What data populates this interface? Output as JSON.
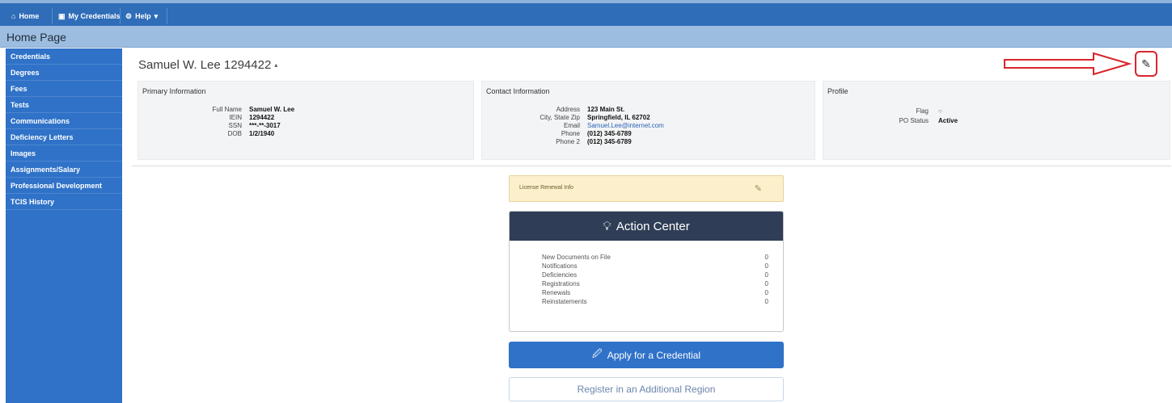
{
  "topnav": {
    "home": "Home",
    "my_credentials": "My Credentials",
    "help": "Help"
  },
  "page_title": "Home Page",
  "sidebar": {
    "items": [
      {
        "label": "Credentials"
      },
      {
        "label": "Degrees"
      },
      {
        "label": "Fees"
      },
      {
        "label": "Tests"
      },
      {
        "label": "Communications"
      },
      {
        "label": "Deficiency Letters"
      },
      {
        "label": "Images"
      },
      {
        "label": "Assignments/Salary"
      },
      {
        "label": "Professional Development"
      },
      {
        "label": "TCIS History"
      }
    ]
  },
  "person": {
    "name": "Samuel W. Lee 1294422",
    "caret": "▴"
  },
  "primary": {
    "title": "Primary Information",
    "rows": [
      {
        "k": "Full Name",
        "v": "Samuel W. Lee"
      },
      {
        "k": "IEIN",
        "v": "1294422"
      },
      {
        "k": "SSN",
        "v": "***-**-3017"
      },
      {
        "k": "DOB",
        "v": "1/2/1940"
      }
    ]
  },
  "contact": {
    "title": "Contact Information",
    "rows": [
      {
        "k": "Address",
        "v": "123 Main St."
      },
      {
        "k": "City, State Zip",
        "v": "Springfield, IL 62702"
      },
      {
        "k": "Email",
        "v": "Samuel.Lee@internet.com"
      },
      {
        "k": "Phone",
        "v": "(012) 345-6789"
      },
      {
        "k": "Phone 2",
        "v": "(012) 345-6789"
      }
    ]
  },
  "profile": {
    "title": "Profile",
    "flag_label": "Flag",
    "flag_value": "○",
    "status_label": "PO Status",
    "status_value": "Active"
  },
  "license": {
    "label": "License Renewal Info"
  },
  "action_center": {
    "title": "Action Center",
    "rows": [
      {
        "label": "New Documents on File",
        "count": "0"
      },
      {
        "label": "Notifications",
        "count": "0"
      },
      {
        "label": "Deficiencies",
        "count": "0"
      },
      {
        "label": "Registrations",
        "count": "0"
      },
      {
        "label": "Renewals",
        "count": "0"
      },
      {
        "label": "Reinstatements",
        "count": "0"
      }
    ]
  },
  "buttons": {
    "apply": "Apply for a Credential",
    "register": "Register in an Additional Region"
  },
  "icons": {
    "home": "home-icon",
    "credentials": "id-card-icon",
    "help": "gear-icon",
    "edit": "edit-icon",
    "lightbulb": "lightbulb-icon",
    "apply": "document-pen-icon"
  },
  "colors": {
    "topbar": "#2f6db8",
    "titlebar": "#9dbde0",
    "sidebar": "#2f72c8",
    "action_center_header": "#2f3e56",
    "license_bg": "#fcf0cc",
    "highlight_red": "#d8262e"
  }
}
